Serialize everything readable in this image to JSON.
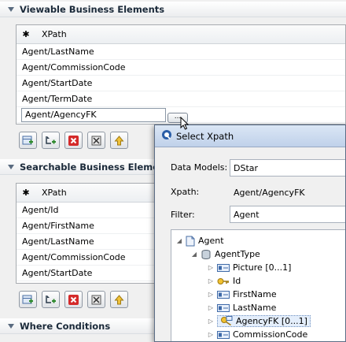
{
  "viewable": {
    "title": "Viewable Business Elements",
    "column": "XPath",
    "star": "✱",
    "rows": [
      "Agent/LastName",
      "Agent/CommissionCode",
      "Agent/StartDate",
      "Agent/TermDate"
    ],
    "editing_value": "Agent/AgencyFK",
    "ellipsis_label": "..."
  },
  "searchable": {
    "title": "Searchable Business Elements",
    "column": "XPath",
    "star": "✱",
    "rows": [
      "Agent/Id",
      "Agent/FirstName",
      "Agent/LastName",
      "Agent/CommissionCode",
      "Agent/StartDate"
    ]
  },
  "where": {
    "title": "Where Conditions"
  },
  "toolbar_icons": [
    "add-row-icon",
    "add-child-icon",
    "delete-icon",
    "clear-icon",
    "move-up-icon"
  ],
  "dialog": {
    "title": "Select Xpath",
    "data_models_label": "Data Models:",
    "data_models_value": "DStar",
    "xpath_label": "Xpath:",
    "xpath_value": "Agent/AgencyFK",
    "filter_label": "Filter:",
    "filter_value": "Agent",
    "tree": {
      "root": "Agent",
      "type": "AgentType",
      "children": [
        "Picture  [0...1]",
        "Id",
        "FirstName",
        "LastName",
        "AgencyFK  [0...1]",
        "CommissionCode"
      ]
    }
  },
  "colors": {
    "accent": "#1b2a3a",
    "selection": "#e4eefb",
    "delete_red": "#d42a2a",
    "add_green": "#2f8a2f"
  }
}
